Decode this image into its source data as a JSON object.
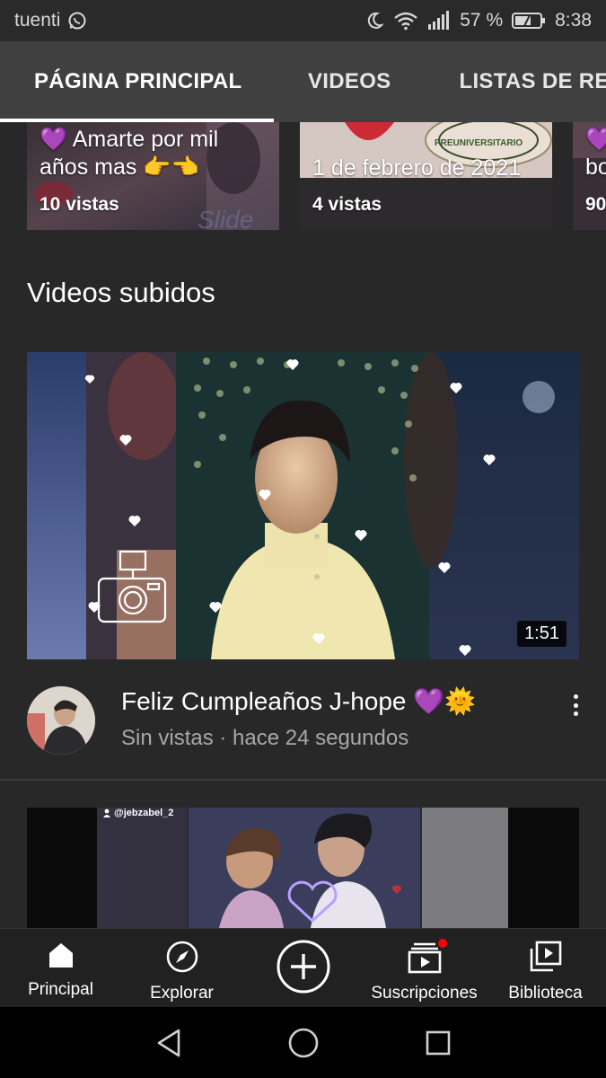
{
  "status_bar": {
    "carrier": "tuenti",
    "battery_percent": "57 %",
    "time": "8:38",
    "icons": [
      "whatsapp-icon",
      "moon-icon",
      "wifi-icon",
      "signal-icon",
      "battery-icon"
    ]
  },
  "tabs": [
    {
      "label": "PÁGINA PRINCIPAL",
      "active": true
    },
    {
      "label": "VIDEOS",
      "active": false
    },
    {
      "label": "LISTAS DE REPRODUCCIÓN",
      "active": false
    }
  ],
  "carousel": [
    {
      "title": "💜 Amarte por mil años mas 👉👈",
      "views": "10 vistas"
    },
    {
      "title": "1 de febrero de 2021",
      "views": "4 vistas"
    },
    {
      "title": "💜 bo",
      "views": "90"
    }
  ],
  "section": {
    "title": "Videos subidos"
  },
  "videos": [
    {
      "title": "Feliz Cumpleaños J-hope 💜🌞",
      "subtitle": "Sin vistas · hace 24 segundos",
      "duration": "1:51"
    },
    {
      "watermark": "@jebzabel_2"
    }
  ],
  "bottom_nav": [
    {
      "label": "Principal",
      "icon": "home-icon"
    },
    {
      "label": "Explorar",
      "icon": "compass-icon"
    },
    {
      "label": "",
      "icon": "create-icon"
    },
    {
      "label": "Suscripciones",
      "icon": "subscriptions-icon",
      "badge": true
    },
    {
      "label": "Biblioteca",
      "icon": "library-icon"
    }
  ],
  "colors": {
    "background": "#282828",
    "tab_bar": "#404040",
    "bottom_nav": "#212121",
    "badge_red": "#ff0000",
    "secondary_text": "#a8a8a8"
  }
}
